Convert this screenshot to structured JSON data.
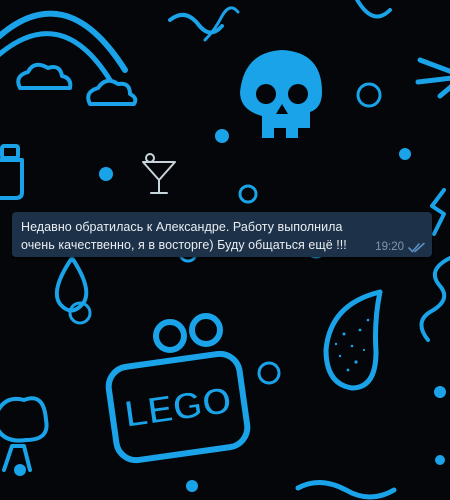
{
  "wallpaper": {
    "accent_color": "#1aa3e8",
    "background_color": "#040609",
    "icons": [
      "rainbow-icon",
      "cloud-icon",
      "skull-icon",
      "cocktail-icon",
      "lego-icon",
      "drop-icon",
      "tree-icon",
      "wave-icon",
      "circle-icon"
    ],
    "lego_label": "LEGO"
  },
  "message": {
    "text": "Недавно обратилась к Александре. Работу выполнила очень качественно, я в восторге) Буду общаться ещё !!!",
    "time": "19:20",
    "status": "read",
    "bubble_color": "#1d3148",
    "ticks_color": "#5c8fc2"
  }
}
